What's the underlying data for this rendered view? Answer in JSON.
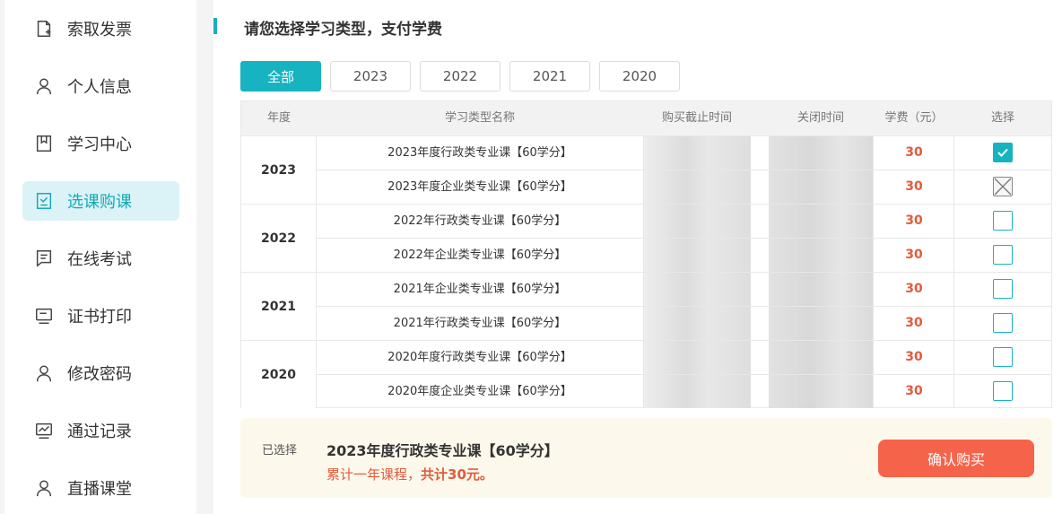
{
  "sidebar": {
    "items": [
      {
        "label": "索取发票",
        "icon": "invoice-icon"
      },
      {
        "label": "个人信息",
        "icon": "user-icon"
      },
      {
        "label": "学习中心",
        "icon": "book-icon"
      },
      {
        "label": "选课购课",
        "icon": "checklist-icon",
        "active": true
      },
      {
        "label": "在线考试",
        "icon": "exam-icon"
      },
      {
        "label": "证书打印",
        "icon": "certificate-icon"
      },
      {
        "label": "修改密码",
        "icon": "user-lock-icon"
      },
      {
        "label": "通过记录",
        "icon": "chart-record-icon"
      },
      {
        "label": "直播课堂",
        "icon": "live-user-icon"
      }
    ]
  },
  "main": {
    "title": "请您选择学习类型，支付学费",
    "filters": [
      "全部",
      "2023",
      "2022",
      "2021",
      "2020"
    ],
    "active_filter": "全部"
  },
  "table": {
    "headers": [
      "年度",
      "学习类型名称",
      "购买截止时间",
      "关闭时间",
      "学费（元）",
      "选择"
    ],
    "groups": [
      {
        "year": "2023",
        "rows": [
          {
            "name": "2023年度行政类专业课【60学分】",
            "fee": "30",
            "state": "checked"
          },
          {
            "name": "2023年度企业类专业课【60学分】",
            "fee": "30",
            "state": "disabled"
          }
        ]
      },
      {
        "year": "2022",
        "rows": [
          {
            "name": "2022年行政类专业课【60学分】",
            "fee": "30",
            "state": "unchecked"
          },
          {
            "name": "2022年企业类专业课【60学分】",
            "fee": "30",
            "state": "unchecked"
          }
        ]
      },
      {
        "year": "2021",
        "rows": [
          {
            "name": "2021年企业类专业课【60学分】",
            "fee": "30",
            "state": "unchecked"
          },
          {
            "name": "2021年行政类专业课【60学分】",
            "fee": "30",
            "state": "unchecked"
          }
        ]
      },
      {
        "year": "2020",
        "rows": [
          {
            "name": "2020年度行政类专业课【60学分】",
            "fee": "30",
            "state": "unchecked"
          },
          {
            "name": "2020年度企业类专业课【60学分】",
            "fee": "30",
            "state": "unchecked"
          }
        ]
      }
    ]
  },
  "summary": {
    "label": "已选择",
    "course": "2023年度行政类专业课【60学分】",
    "note_prefix": "累计一年课程，",
    "note_total": "共计30元。",
    "confirm_label": "确认购买"
  },
  "colors": {
    "accent": "#17b3c1",
    "fee": "#e25b3a",
    "confirm": "#f5644a",
    "summary_bg": "#fdf8ec"
  }
}
